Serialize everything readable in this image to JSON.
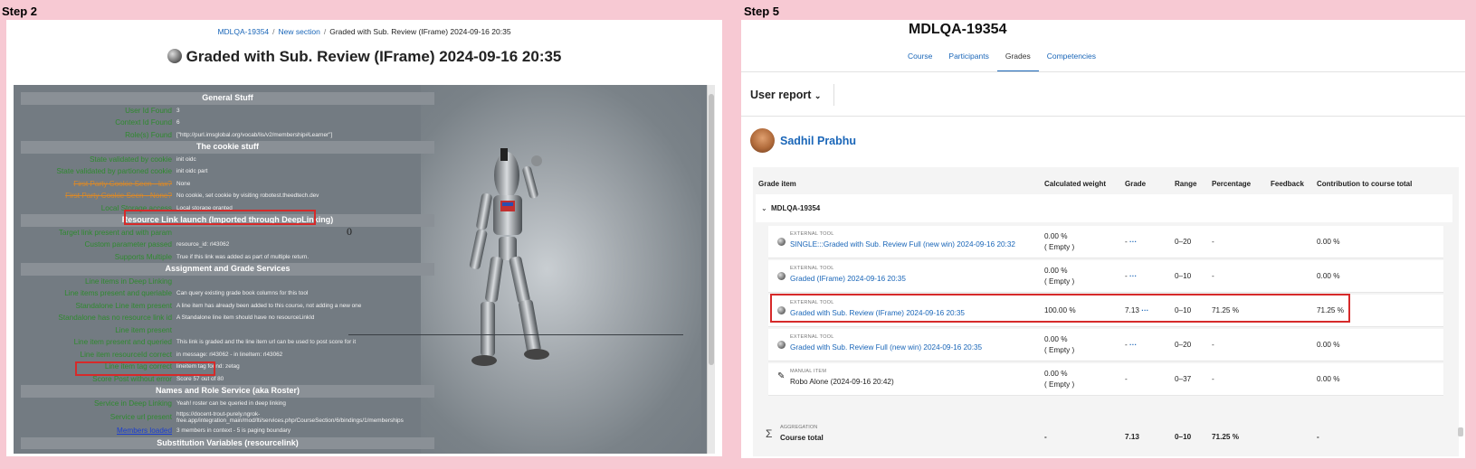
{
  "left": {
    "step_label": "Step 2",
    "breadcrumb": [
      "MDLQA-19354",
      "New section",
      "Graded with Sub. Review (IFrame) 2024-09-16 20:35"
    ],
    "title": "Graded with Sub. Review (IFrame) 2024-09-16 20:35",
    "tool_output": {
      "stray_number": "0",
      "rows": [
        {
          "kind": "section",
          "text": "General Stuff"
        },
        {
          "kind": "row",
          "label": "User Id Found",
          "value": "3"
        },
        {
          "kind": "row",
          "label": "Context Id Found",
          "value": "6"
        },
        {
          "kind": "row",
          "label": "Role(s) Found",
          "value": "[\"http://purl.imsglobal.org/vocab/lis/v2/membership#Learner\"]"
        },
        {
          "kind": "section",
          "text": "The cookie stuff"
        },
        {
          "kind": "row",
          "label": "State validated by cookie",
          "value": "init oidc"
        },
        {
          "kind": "row",
          "label": "State validated by partioned cookie",
          "value": "init oidc part"
        },
        {
          "kind": "row",
          "label": "First Party Cookie Seen - lax?",
          "value": "None",
          "style": "strike"
        },
        {
          "kind": "row",
          "label": "First Party Cookie Seen - None?",
          "value": "No cookie, set cookie by visiting robotest.theedtech.dev",
          "style": "strike"
        },
        {
          "kind": "row",
          "label": "Local Storage access",
          "value": "Local storage granted"
        },
        {
          "kind": "section",
          "text": "Resource Link launch (Imported through DeepLinking)"
        },
        {
          "kind": "row",
          "label": "Target link present and with param",
          "value": ""
        },
        {
          "kind": "row",
          "label": "Custom parameter passed",
          "value": "resource_id: rl43062"
        },
        {
          "kind": "row",
          "label": "Supports Multiple",
          "value": "True if this link was added as part of multiple return."
        },
        {
          "kind": "section",
          "text": "Assignment and Grade Services"
        },
        {
          "kind": "row",
          "label": "Line items in Deep Linking",
          "value": ""
        },
        {
          "kind": "row",
          "label": "Line items present and queriable",
          "value": "Can query existing grade book columns for this tool"
        },
        {
          "kind": "row",
          "label": "Standalone Line item present",
          "value": "A line item has already been added to this course, not adding a new one"
        },
        {
          "kind": "row",
          "label": "Standalone has no resource link id",
          "value": "A Standalone line item should have no resourceLinkId"
        },
        {
          "kind": "row",
          "label": "Line item present",
          "value": ""
        },
        {
          "kind": "row",
          "label": "Line item present and queried",
          "value": "This link is graded and the line item url can be used to post score for it"
        },
        {
          "kind": "row",
          "label": "Line item resourceId correct",
          "value": "in message: rl43062 - in lineItem: rl43062"
        },
        {
          "kind": "row",
          "label": "Line item tag correct",
          "value": "lineitem tag found: zetag"
        },
        {
          "kind": "row",
          "label": "Score Post without error",
          "value": "Score 57 out of 80"
        },
        {
          "kind": "section",
          "text": "Names and Role Service (aka Roster)"
        },
        {
          "kind": "row",
          "label": "Service in Deep Linking",
          "value": "Yeah! roster can be queried in deep linking"
        },
        {
          "kind": "row",
          "label": "Service url present",
          "value": "https://docent-trout-purely.ngrok-free.app/integration_main/mod/lti/services.php/CourseSection/6/bindings/1/memberships",
          "style": "tall"
        },
        {
          "kind": "row",
          "label": "Members loaded",
          "value": "3 members in context - 5 is paging boundary",
          "style": "blue"
        },
        {
          "kind": "section",
          "text": "Substitution Variables (resourcelink)"
        }
      ]
    }
  },
  "right": {
    "step_label": "Step 5",
    "course_title": "MDLQA-19354",
    "tabs": [
      "Course",
      "Participants",
      "Grades",
      "Competencies"
    ],
    "active_tab": "Grades",
    "report_selector": "User report",
    "user_name": "Sadhil Prabhu",
    "columns": [
      "Grade item",
      "Calculated weight",
      "Grade",
      "Range",
      "Percentage",
      "Feedback",
      "Contribution to course total"
    ],
    "category": "MDLQA-19354",
    "items": [
      {
        "type": "EXTERNAL TOOL",
        "name": "SINGLE:::Graded with Sub. Review Full (new win) 2024-09-16 20:32",
        "weight": "0.00 %",
        "weight_note": "( Empty )",
        "grade": "-",
        "range": "0–20",
        "percentage": "-",
        "feedback": "",
        "contribution": "0.00 %"
      },
      {
        "type": "EXTERNAL TOOL",
        "name": "Graded (IFrame) 2024-09-16 20:35",
        "weight": "0.00 %",
        "weight_note": "( Empty )",
        "grade": "-",
        "range": "0–10",
        "percentage": "-",
        "feedback": "",
        "contribution": "0.00 %"
      },
      {
        "type": "EXTERNAL TOOL",
        "name": "Graded with Sub. Review (IFrame) 2024-09-16 20:35",
        "weight": "100.00 %",
        "weight_note": "",
        "grade": "7.13",
        "range": "0–10",
        "percentage": "71.25 %",
        "feedback": "",
        "contribution": "71.25 %",
        "highlighted": true
      },
      {
        "type": "EXTERNAL TOOL",
        "name": "Graded with Sub. Review Full (new win) 2024-09-16 20:35",
        "weight": "0.00 %",
        "weight_note": "( Empty )",
        "grade": "-",
        "range": "0–20",
        "percentage": "-",
        "feedback": "",
        "contribution": "0.00 %"
      },
      {
        "type": "MANUAL ITEM",
        "name": "Robo Alone (2024-09-16 20:42)",
        "weight": "0.00 %",
        "weight_note": "( Empty )",
        "grade": "-",
        "range": "0–37",
        "percentage": "-",
        "feedback": "",
        "contribution": "0.00 %",
        "manual": true
      }
    ],
    "aggregation": {
      "type": "AGGREGATION",
      "name": "Course total",
      "weight": "-",
      "grade": "7.13",
      "range": "0–10",
      "percentage": "71.25 %",
      "contribution": "-"
    }
  }
}
